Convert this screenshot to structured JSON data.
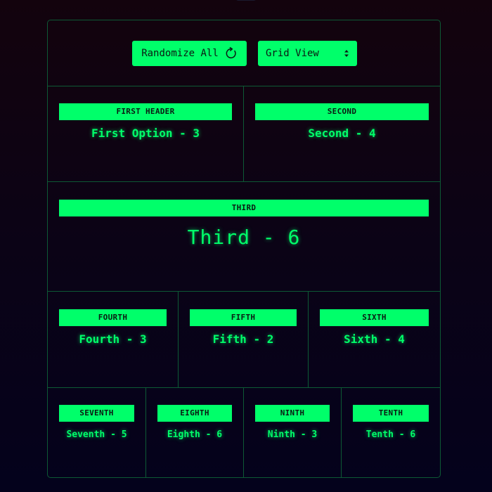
{
  "toolbar": {
    "randomize_label": "Randomize All",
    "randomize_icon": "refresh-icon",
    "view_select": {
      "selected": "Grid View",
      "icon": "select-arrows-icon"
    }
  },
  "colors": {
    "accent": "#00ff6a",
    "border": "#0d5a35",
    "dark_text": "#0a1a12",
    "background_top": "#13030d",
    "background_bottom": "#04021c"
  },
  "cards": [
    {
      "header": "FIRST HEADER",
      "value": "First Option - 3"
    },
    {
      "header": "SECOND",
      "value": "Second - 4"
    },
    {
      "header": "THIRD",
      "value": "Third - 6"
    },
    {
      "header": "FOURTH",
      "value": "Fourth - 3"
    },
    {
      "header": "FIFTH",
      "value": "Fifth - 2"
    },
    {
      "header": "SIXTH",
      "value": "Sixth - 4"
    },
    {
      "header": "SEVENTH",
      "value": "Seventh - 5"
    },
    {
      "header": "EIGHTH",
      "value": "Eighth - 6"
    },
    {
      "header": "NINTH",
      "value": "Ninth - 3"
    },
    {
      "header": "TENTH",
      "value": "Tenth - 6"
    }
  ]
}
